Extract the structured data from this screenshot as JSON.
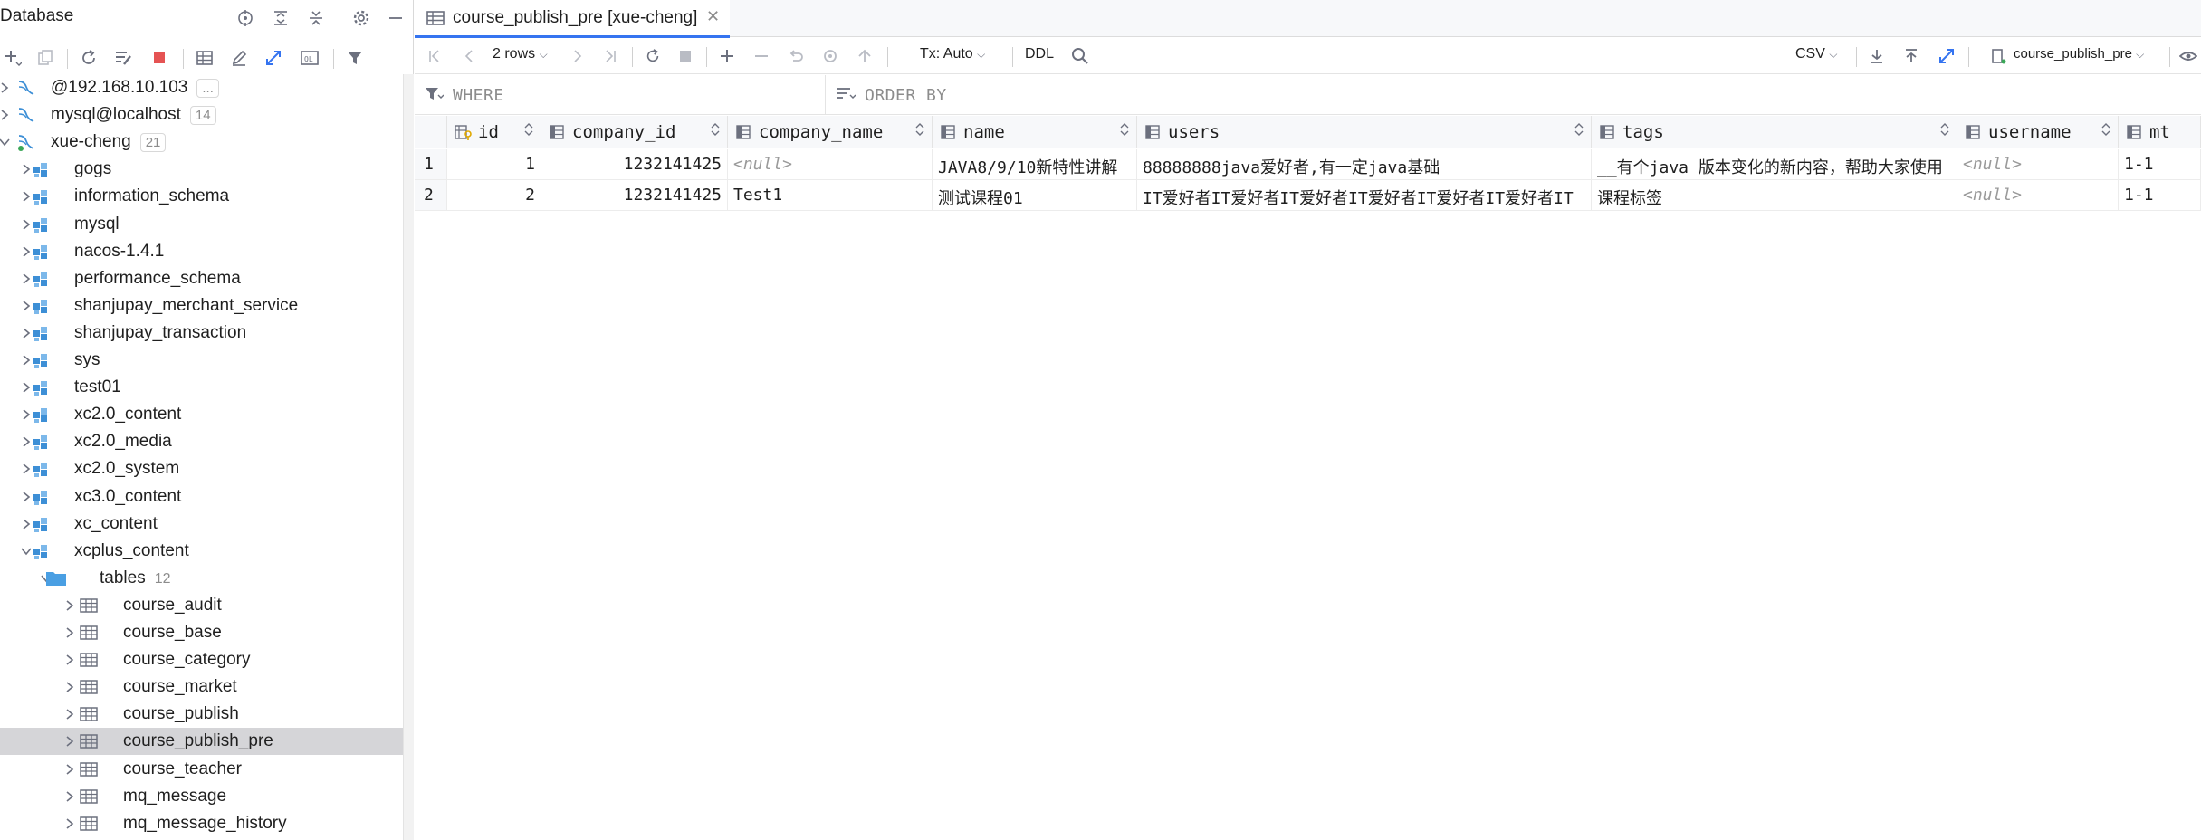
{
  "left_panel": {
    "title": "Database",
    "tree": [
      {
        "label": "@192.168.10.103",
        "badge": "...",
        "type": "connection",
        "level": 0,
        "expanded": false
      },
      {
        "label": "mysql@localhost",
        "badge": "14",
        "type": "connection",
        "level": 0,
        "expanded": false
      },
      {
        "label": "xue-cheng",
        "badge": "21",
        "type": "connection-active",
        "level": 0,
        "expanded": true
      },
      {
        "label": "gogs",
        "type": "schema",
        "level": 1,
        "expanded": false
      },
      {
        "label": "information_schema",
        "type": "schema",
        "level": 1,
        "expanded": false
      },
      {
        "label": "mysql",
        "type": "schema",
        "level": 1,
        "expanded": false
      },
      {
        "label": "nacos-1.4.1",
        "type": "schema",
        "level": 1,
        "expanded": false
      },
      {
        "label": "performance_schema",
        "type": "schema",
        "level": 1,
        "expanded": false
      },
      {
        "label": "shanjupay_merchant_service",
        "type": "schema",
        "level": 1,
        "expanded": false
      },
      {
        "label": "shanjupay_transaction",
        "type": "schema",
        "level": 1,
        "expanded": false
      },
      {
        "label": "sys",
        "type": "schema",
        "level": 1,
        "expanded": false
      },
      {
        "label": "test01",
        "type": "schema",
        "level": 1,
        "expanded": false
      },
      {
        "label": "xc2.0_content",
        "type": "schema",
        "level": 1,
        "expanded": false
      },
      {
        "label": "xc2.0_media",
        "type": "schema",
        "level": 1,
        "expanded": false
      },
      {
        "label": "xc2.0_system",
        "type": "schema",
        "level": 1,
        "expanded": false
      },
      {
        "label": "xc3.0_content",
        "type": "schema",
        "level": 1,
        "expanded": false
      },
      {
        "label": "xc_content",
        "type": "schema",
        "level": 1,
        "expanded": false
      },
      {
        "label": "xcplus_content",
        "type": "schema",
        "level": 1,
        "expanded": true
      },
      {
        "label": "tables",
        "count": "12",
        "type": "folder",
        "level": 2,
        "expanded": true
      },
      {
        "label": "course_audit",
        "type": "table",
        "level": 3,
        "expanded": false
      },
      {
        "label": "course_base",
        "type": "table",
        "level": 3,
        "expanded": false
      },
      {
        "label": "course_category",
        "type": "table",
        "level": 3,
        "expanded": false
      },
      {
        "label": "course_market",
        "type": "table",
        "level": 3,
        "expanded": false
      },
      {
        "label": "course_publish",
        "type": "table",
        "level": 3,
        "expanded": false
      },
      {
        "label": "course_publish_pre",
        "type": "table",
        "level": 3,
        "expanded": false,
        "selected": true
      },
      {
        "label": "course_teacher",
        "type": "table",
        "level": 3,
        "expanded": false
      },
      {
        "label": "mq_message",
        "type": "table",
        "level": 3,
        "expanded": false
      },
      {
        "label": "mq_message_history",
        "type": "table",
        "level": 3,
        "expanded": false
      }
    ]
  },
  "editor": {
    "tab_label": "course_publish_pre [xue-cheng]",
    "toolbar": {
      "rows_label": "2 rows",
      "tx_label": "Tx: Auto",
      "ddl_label": "DDL",
      "export_format": "CSV",
      "table_selector": "course_publish_pre"
    },
    "filter": {
      "where_placeholder": "WHERE",
      "orderby_placeholder": "ORDER BY"
    },
    "grid": {
      "columns": [
        "id",
        "company_id",
        "company_name",
        "name",
        "users",
        "tags",
        "username",
        "mt"
      ],
      "rows": [
        {
          "rownum": "1",
          "id": "1",
          "company_id": "1232141425",
          "company_name": "<null>",
          "name": "JAVA8/9/10新特性讲解",
          "users": "88888888java爱好者,有一定java基础",
          "tags": "__有个java 版本变化的新内容，帮助大家使用",
          "username": "<null>",
          "mt": "1-1"
        },
        {
          "rownum": "2",
          "id": "2",
          "company_id": "1232141425",
          "company_name": "Test1",
          "name": "测试课程01",
          "users": "IT爱好者IT爱好者IT爱好者IT爱好者IT爱好者IT爱好者IT",
          "tags": "课程标签",
          "username": "<null>",
          "mt": "1-1"
        }
      ]
    }
  },
  "colors": {
    "accent": "#3574f0",
    "schema_icon": "#3d8fd6",
    "folder_icon": "#4a9fe3",
    "stop_red": "#e55353",
    "selected_row": "#d5d5d8"
  }
}
